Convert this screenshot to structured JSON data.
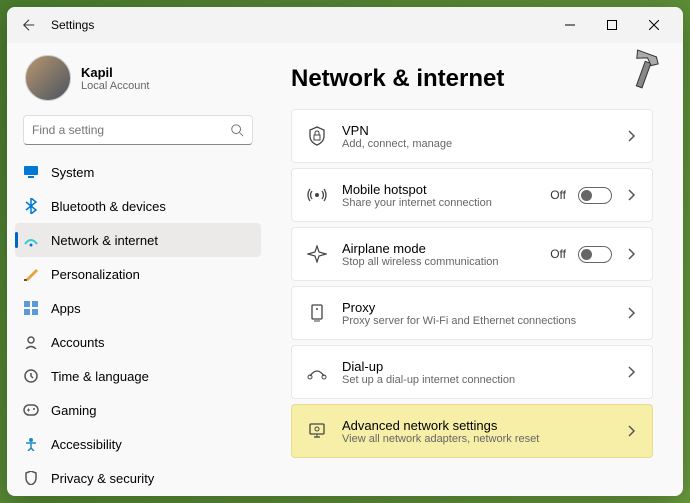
{
  "window": {
    "title": "Settings"
  },
  "profile": {
    "name": "Kapil",
    "sub": "Local Account"
  },
  "search": {
    "placeholder": "Find a setting"
  },
  "nav": [
    {
      "id": "system",
      "label": "System"
    },
    {
      "id": "bluetooth",
      "label": "Bluetooth & devices"
    },
    {
      "id": "network",
      "label": "Network & internet",
      "selected": true
    },
    {
      "id": "personalization",
      "label": "Personalization"
    },
    {
      "id": "apps",
      "label": "Apps"
    },
    {
      "id": "accounts",
      "label": "Accounts"
    },
    {
      "id": "time",
      "label": "Time & language"
    },
    {
      "id": "gaming",
      "label": "Gaming"
    },
    {
      "id": "accessibility",
      "label": "Accessibility"
    },
    {
      "id": "privacy",
      "label": "Privacy & security"
    }
  ],
  "page": {
    "title": "Network & internet"
  },
  "items": [
    {
      "id": "vpn",
      "title": "VPN",
      "sub": "Add, connect, manage"
    },
    {
      "id": "hotspot",
      "title": "Mobile hotspot",
      "sub": "Share your internet connection",
      "toggle": "Off"
    },
    {
      "id": "airplane",
      "title": "Airplane mode",
      "sub": "Stop all wireless communication",
      "toggle": "Off"
    },
    {
      "id": "proxy",
      "title": "Proxy",
      "sub": "Proxy server for Wi-Fi and Ethernet connections"
    },
    {
      "id": "dialup",
      "title": "Dial-up",
      "sub": "Set up a dial-up internet connection"
    },
    {
      "id": "advanced",
      "title": "Advanced network settings",
      "sub": "View all network adapters, network reset",
      "highlight": true
    }
  ]
}
